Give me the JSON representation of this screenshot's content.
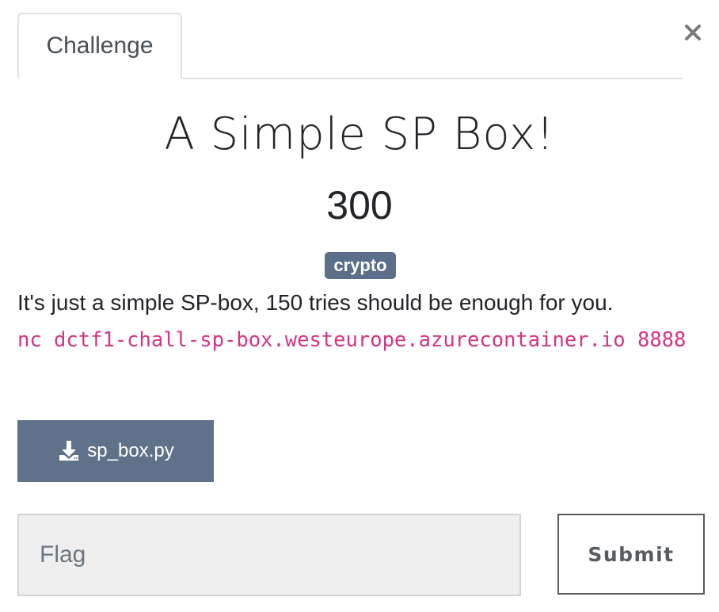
{
  "tabs": [
    {
      "label": "Challenge",
      "active": true
    }
  ],
  "close": {
    "icon": "close-icon",
    "glyph": "✕"
  },
  "challenge": {
    "title": "A Simple SP Box!",
    "points": "300",
    "tag": "crypto",
    "description": "It's just a simple SP-box, 150 tries should be enough for you.",
    "connection": "nc dctf1-chall-sp-box.westeurope.azurecontainer.io 8888"
  },
  "download": {
    "icon": "download-icon",
    "label": "sp_box.py"
  },
  "flag": {
    "placeholder": "Flag",
    "value": ""
  },
  "submit": {
    "label": "Submit"
  },
  "colors": {
    "tag_bg": "#5c6f8a",
    "download_bg": "#60718a",
    "code_pink": "#d63384",
    "input_bg": "#efefef"
  }
}
